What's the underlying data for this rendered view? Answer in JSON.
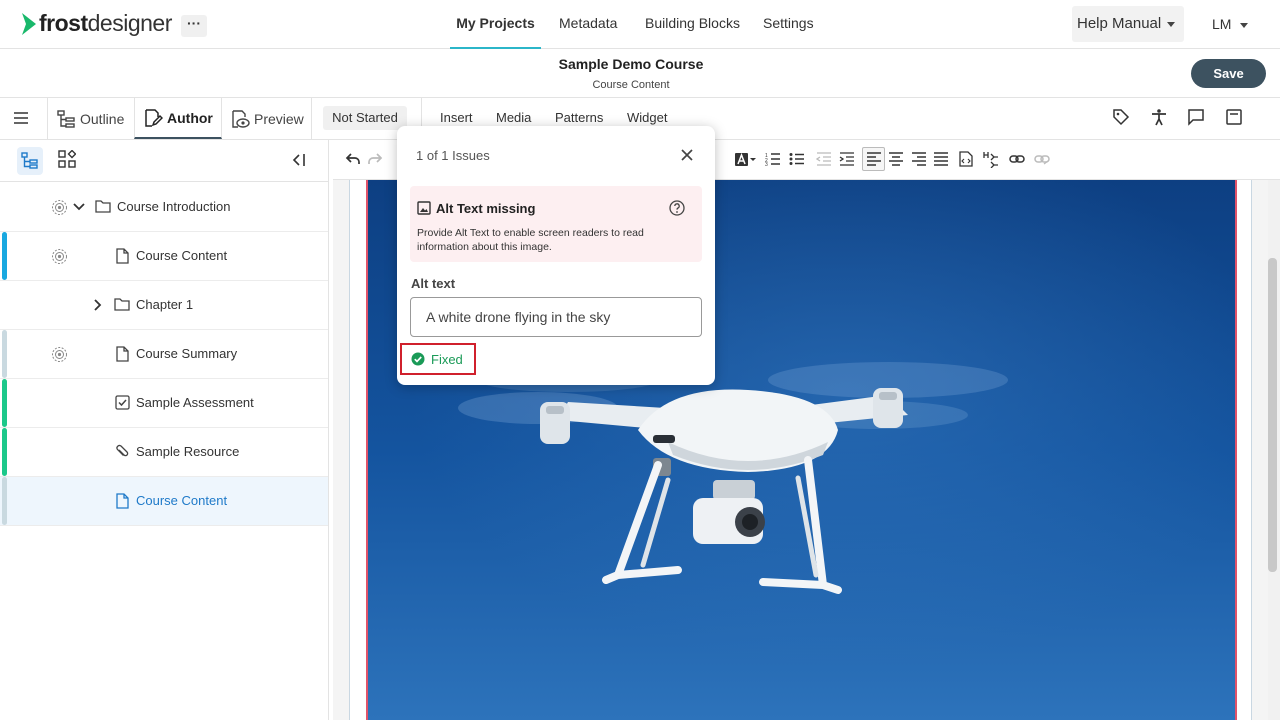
{
  "app": {
    "logo_bold": "frost",
    "logo_light": "designer",
    "more_label": "···"
  },
  "nav": {
    "tabs": [
      {
        "label": "My Projects",
        "active": true
      },
      {
        "label": "Metadata",
        "active": false
      },
      {
        "label": "Building Blocks",
        "active": false
      },
      {
        "label": "Settings",
        "active": false
      }
    ],
    "help_label": "Help Manual",
    "user_initials": "LM"
  },
  "header": {
    "course_title": "Sample Demo Course",
    "course_subtitle": "Course Content",
    "save_label": "Save"
  },
  "modes": {
    "outline_label": "Outline",
    "author_label": "Author",
    "preview_label": "Preview",
    "status_label": "Not Started",
    "insert_label": "Insert",
    "media_label": "Media",
    "patterns_label": "Patterns",
    "widget_label": "Widget"
  },
  "tree": {
    "items": [
      {
        "label": "Course Introduction",
        "icon": "folder-icon"
      },
      {
        "label": "Course Content",
        "icon": "page-icon"
      },
      {
        "label": "Chapter 1",
        "icon": "folder-icon"
      },
      {
        "label": "Course Summary",
        "icon": "page-icon"
      },
      {
        "label": "Sample Assessment",
        "icon": "checkbox-icon"
      },
      {
        "label": "Sample Resource",
        "icon": "paperclip-icon"
      },
      {
        "label": "Course Content",
        "icon": "page-icon"
      }
    ]
  },
  "popover": {
    "issue_count": "1 of 1 Issues",
    "issue_title": "Alt Text missing",
    "issue_description": "Provide Alt Text to enable screen readers to read information about this image.",
    "alt_label": "Alt text",
    "alt_value": "A white drone flying in the sky",
    "fixed_label": "Fixed"
  },
  "colors": {
    "accent": "#2bb6c9",
    "save_bg": "#3d5260",
    "issue_bg": "#fdeff1",
    "fixed_green": "#1a9a57",
    "highlight_red": "#d0202c",
    "sky": "#0f4d95"
  }
}
